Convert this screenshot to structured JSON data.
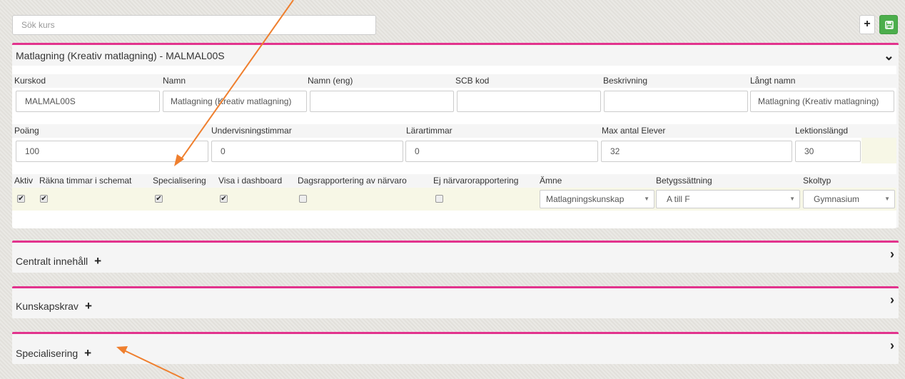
{
  "search": {
    "placeholder": "Sök kurs"
  },
  "toolbar": {
    "add_label": "+"
  },
  "course_panel": {
    "title": "Matlagning (Kreativ matlagning) - MALMAL00S",
    "labels_row1": [
      "Kurskod",
      "Namn",
      "Namn (eng)",
      "SCB kod",
      "Beskrivning",
      "Långt namn"
    ],
    "values_row1": [
      "MALMAL00S",
      "Matlagning (Kreativ matlagning)",
      "",
      "",
      "",
      "Matlagning (Kreativ matlagning)"
    ],
    "labels_row2": [
      "Poäng",
      "Undervisningstimmar",
      "Lärartimmar",
      "Max antal Elever",
      "Lektionslängd"
    ],
    "values_row2": [
      "100",
      "0",
      "0",
      "32",
      "30"
    ],
    "labels_row3": [
      "Aktiv",
      "Räkna timmar i schemat",
      "Specialisering",
      "Visa i dashboard",
      "Dagsrapportering av närvaro",
      "Ej närvarorapportering",
      "Ämne",
      "Betygssättning",
      "Skoltyp"
    ],
    "checkboxes": [
      true,
      true,
      true,
      true,
      false,
      false
    ],
    "amne": "Matlagningskunskap",
    "betyg": "A till F",
    "skoltyp": "Gymnasium"
  },
  "sections": [
    {
      "title": "Centralt innehåll"
    },
    {
      "title": "Kunskapskrav"
    },
    {
      "title": "Specialisering"
    }
  ],
  "colors": {
    "accent": "#e2338d",
    "save": "#4cae4c",
    "annotation": "#ef7f2e",
    "row_highlight": "#f7f7e6"
  }
}
